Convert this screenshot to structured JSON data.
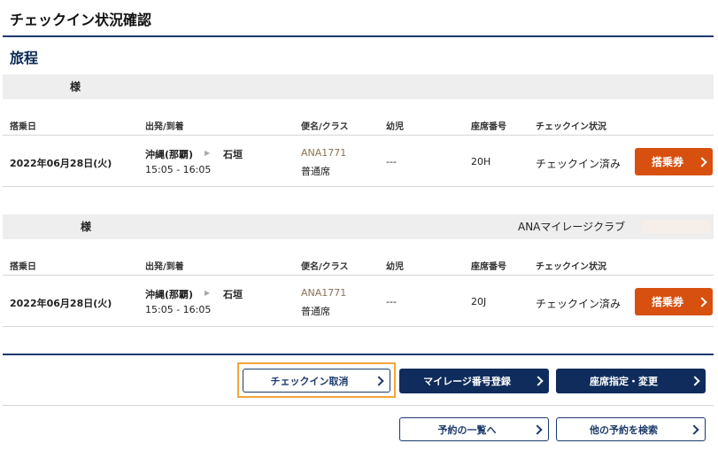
{
  "page": {
    "title": "チェックイン状況確認",
    "section": "旅程"
  },
  "columns": {
    "date": "搭乗日",
    "route": "出発/到着",
    "flight": "便名/クラス",
    "infant": "幼児",
    "seat": "座席番号",
    "status": "チェックイン状況"
  },
  "passengers": [
    {
      "name": "様",
      "club_label": "",
      "date": "2022年06月28日(火)",
      "origin": "沖縄(那覇)",
      "destination": "石垣",
      "times": "15:05 - 16:05",
      "flight_no": "ANA1771",
      "class": "普通席",
      "infant": "---",
      "seat": "20H",
      "status": "チェックイン済み",
      "boarding_pass_label": "搭乗券"
    },
    {
      "name": "様",
      "club_label": "ANAマイレージクラブ",
      "date": "2022年06月28日(火)",
      "origin": "沖縄(那覇)",
      "destination": "石垣",
      "times": "15:05 - 16:05",
      "flight_no": "ANA1771",
      "class": "普通席",
      "infant": "---",
      "seat": "20J",
      "status": "チェックイン済み",
      "boarding_pass_label": "搭乗券"
    }
  ],
  "actions": {
    "cancel_checkin": "チェックイン取消",
    "mileage_register": "マイレージ番号登録",
    "seat_change": "座席指定・変更",
    "reservation_list": "予約の一覧へ",
    "search_other": "他の予約を検索"
  },
  "colors": {
    "navy": "#0f2c5c",
    "orange": "#d7500f",
    "highlight": "#f5a53a"
  }
}
